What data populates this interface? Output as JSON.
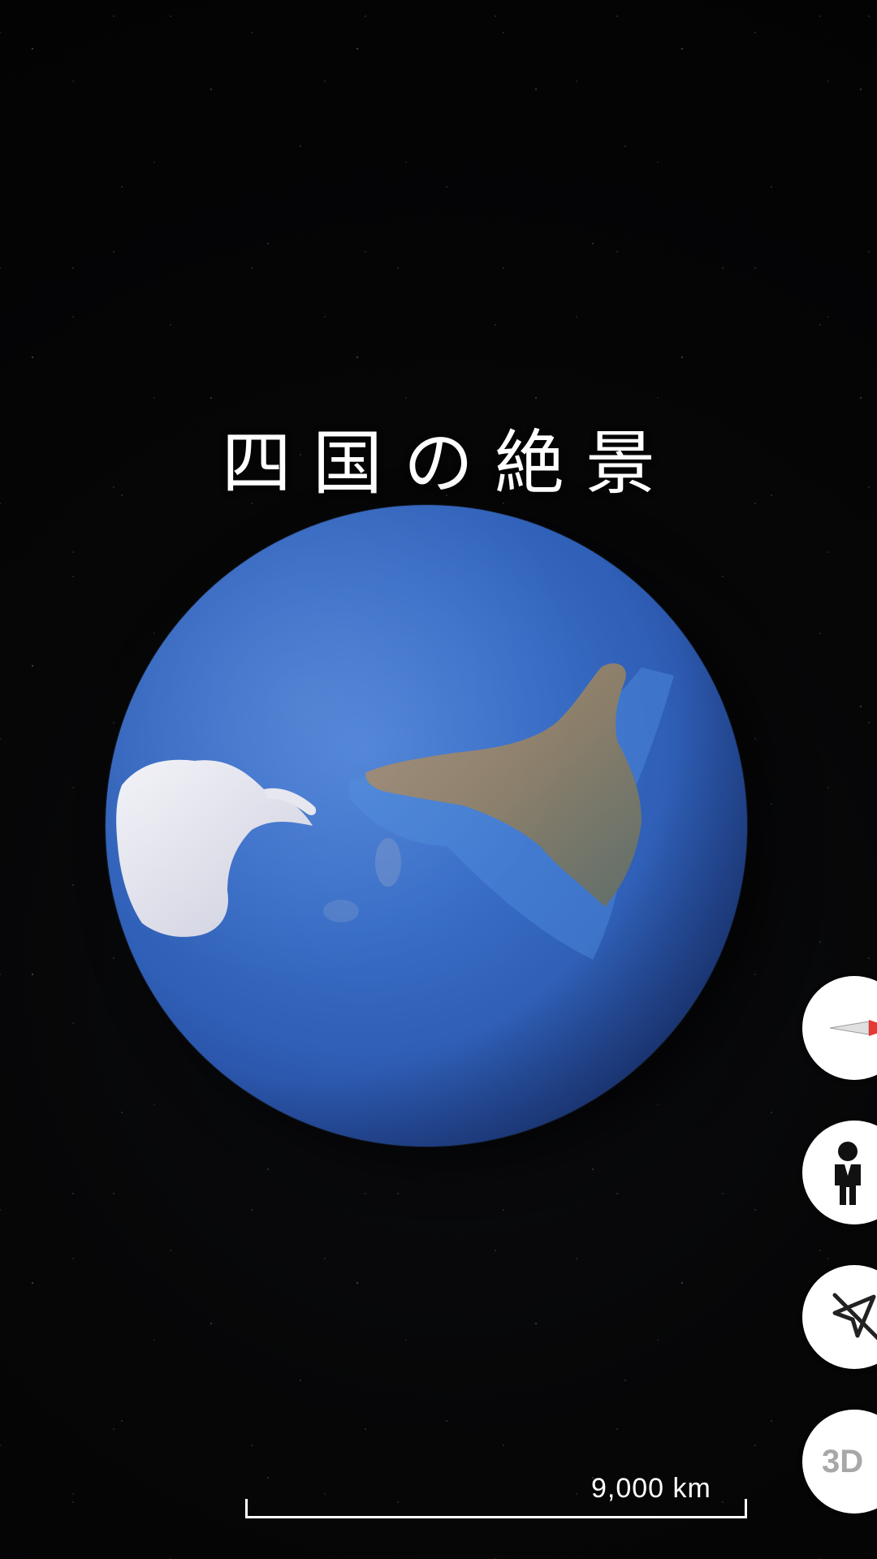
{
  "overlay": {
    "title": "四国の絶景"
  },
  "controls": {
    "compass_icon": "compass-icon",
    "street_view_icon": "pegman-icon",
    "locate_icon": "location-off-icon",
    "view_3d_label": "3D"
  },
  "map": {
    "scale_label": "9,000 km"
  },
  "colors": {
    "ocean": "#3a6fc8",
    "ice": "#e8e8f0",
    "land": "#8a7a6a",
    "compass_red": "#e53935",
    "control_bg": "#ffffff"
  }
}
